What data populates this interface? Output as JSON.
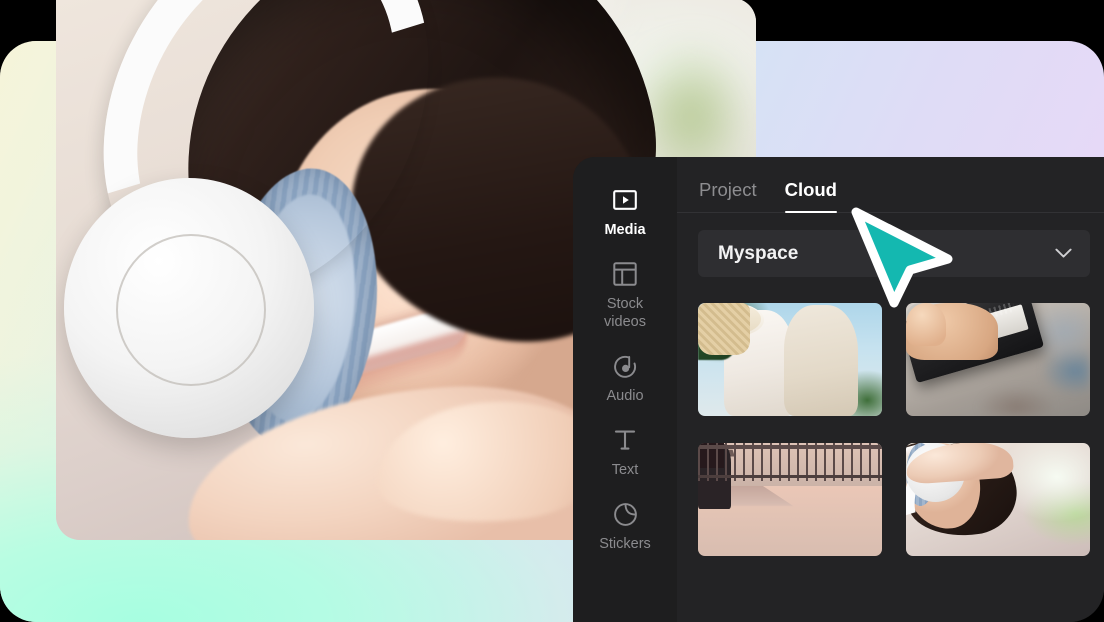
{
  "app": {
    "accent_color": "#14b8b0",
    "panel_bg": "#232325",
    "sidebar_bg": "#1e1e1f",
    "dropdown_bg": "#2e2e31"
  },
  "sidebar": {
    "items": [
      {
        "label": "Media",
        "icon": "media-play-icon",
        "active": true
      },
      {
        "label": "Stock\nvideos",
        "icon": "layout-grid-icon",
        "active": false
      },
      {
        "label": "Audio",
        "icon": "audio-note-icon",
        "active": false
      },
      {
        "label": "Text",
        "icon": "text-t-icon",
        "active": false
      },
      {
        "label": "Stickers",
        "icon": "sticker-peel-icon",
        "active": false
      }
    ],
    "labels": {
      "media": "Media",
      "stock_videos_line1": "Stock",
      "stock_videos_line2": "videos",
      "audio": "Audio",
      "text": "Text",
      "stickers": "Stickers"
    }
  },
  "tabs": [
    {
      "label": "Project",
      "active": false
    },
    {
      "label": "Cloud",
      "active": true
    }
  ],
  "tab_labels": {
    "project": "Project",
    "cloud": "Cloud"
  },
  "dropdown": {
    "value": "Myspace",
    "chevron_icon": "chevron-down-icon"
  },
  "media_grid": {
    "items": [
      {
        "name": "two-women-with-camera-thumbnail"
      },
      {
        "name": "hand-holding-cassette-tape-thumbnail"
      },
      {
        "name": "foggy-harbour-silhouette-thumbnail"
      },
      {
        "name": "woman-with-headphones-thumbnail"
      }
    ]
  },
  "hero": {
    "name": "woman-with-white-headphones-photo"
  },
  "cursor": {
    "name": "teal-arrow-cursor",
    "color": "#14b8b0"
  }
}
